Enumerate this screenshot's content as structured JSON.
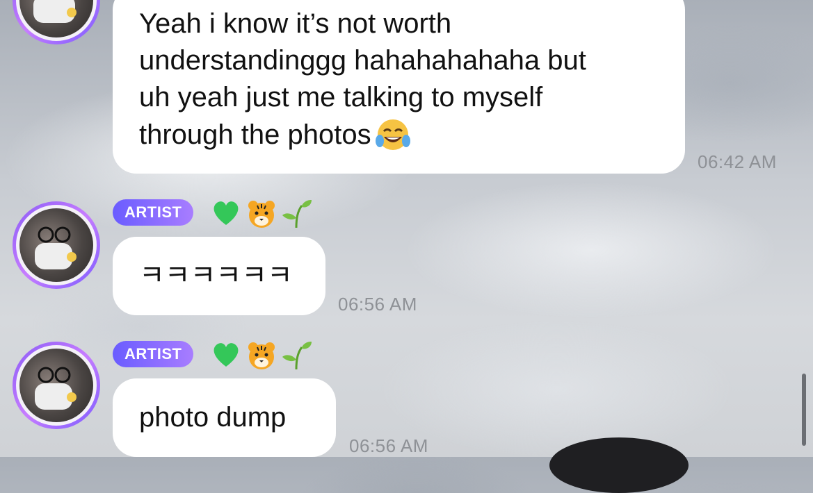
{
  "messages": [
    {
      "text_lines": [
        "Yeah i know it’s not worth",
        "understandinggg hahahahahaha but",
        "uh yeah just me talking to myself",
        "through the photos"
      ],
      "trailing_emoji": "face-with-tears-of-joy",
      "time": "06:42 AM"
    },
    {
      "badge": "ARTIST",
      "badge_emojis": [
        "green-heart",
        "tiger-face",
        "seedling"
      ],
      "text": "ㅋㅋㅋㅋㅋㅋ",
      "time": "06:56 AM"
    },
    {
      "badge": "ARTIST",
      "badge_emojis": [
        "green-heart",
        "tiger-face",
        "seedling"
      ],
      "text": "photo dump",
      "time": "06:56 AM"
    }
  ],
  "colors": {
    "badge_start": "#6a5cff",
    "badge_end": "#a87dff",
    "avatar_ring": "#8a5cf6",
    "bubble": "#ffffff",
    "timestamp": "#8e9196"
  }
}
